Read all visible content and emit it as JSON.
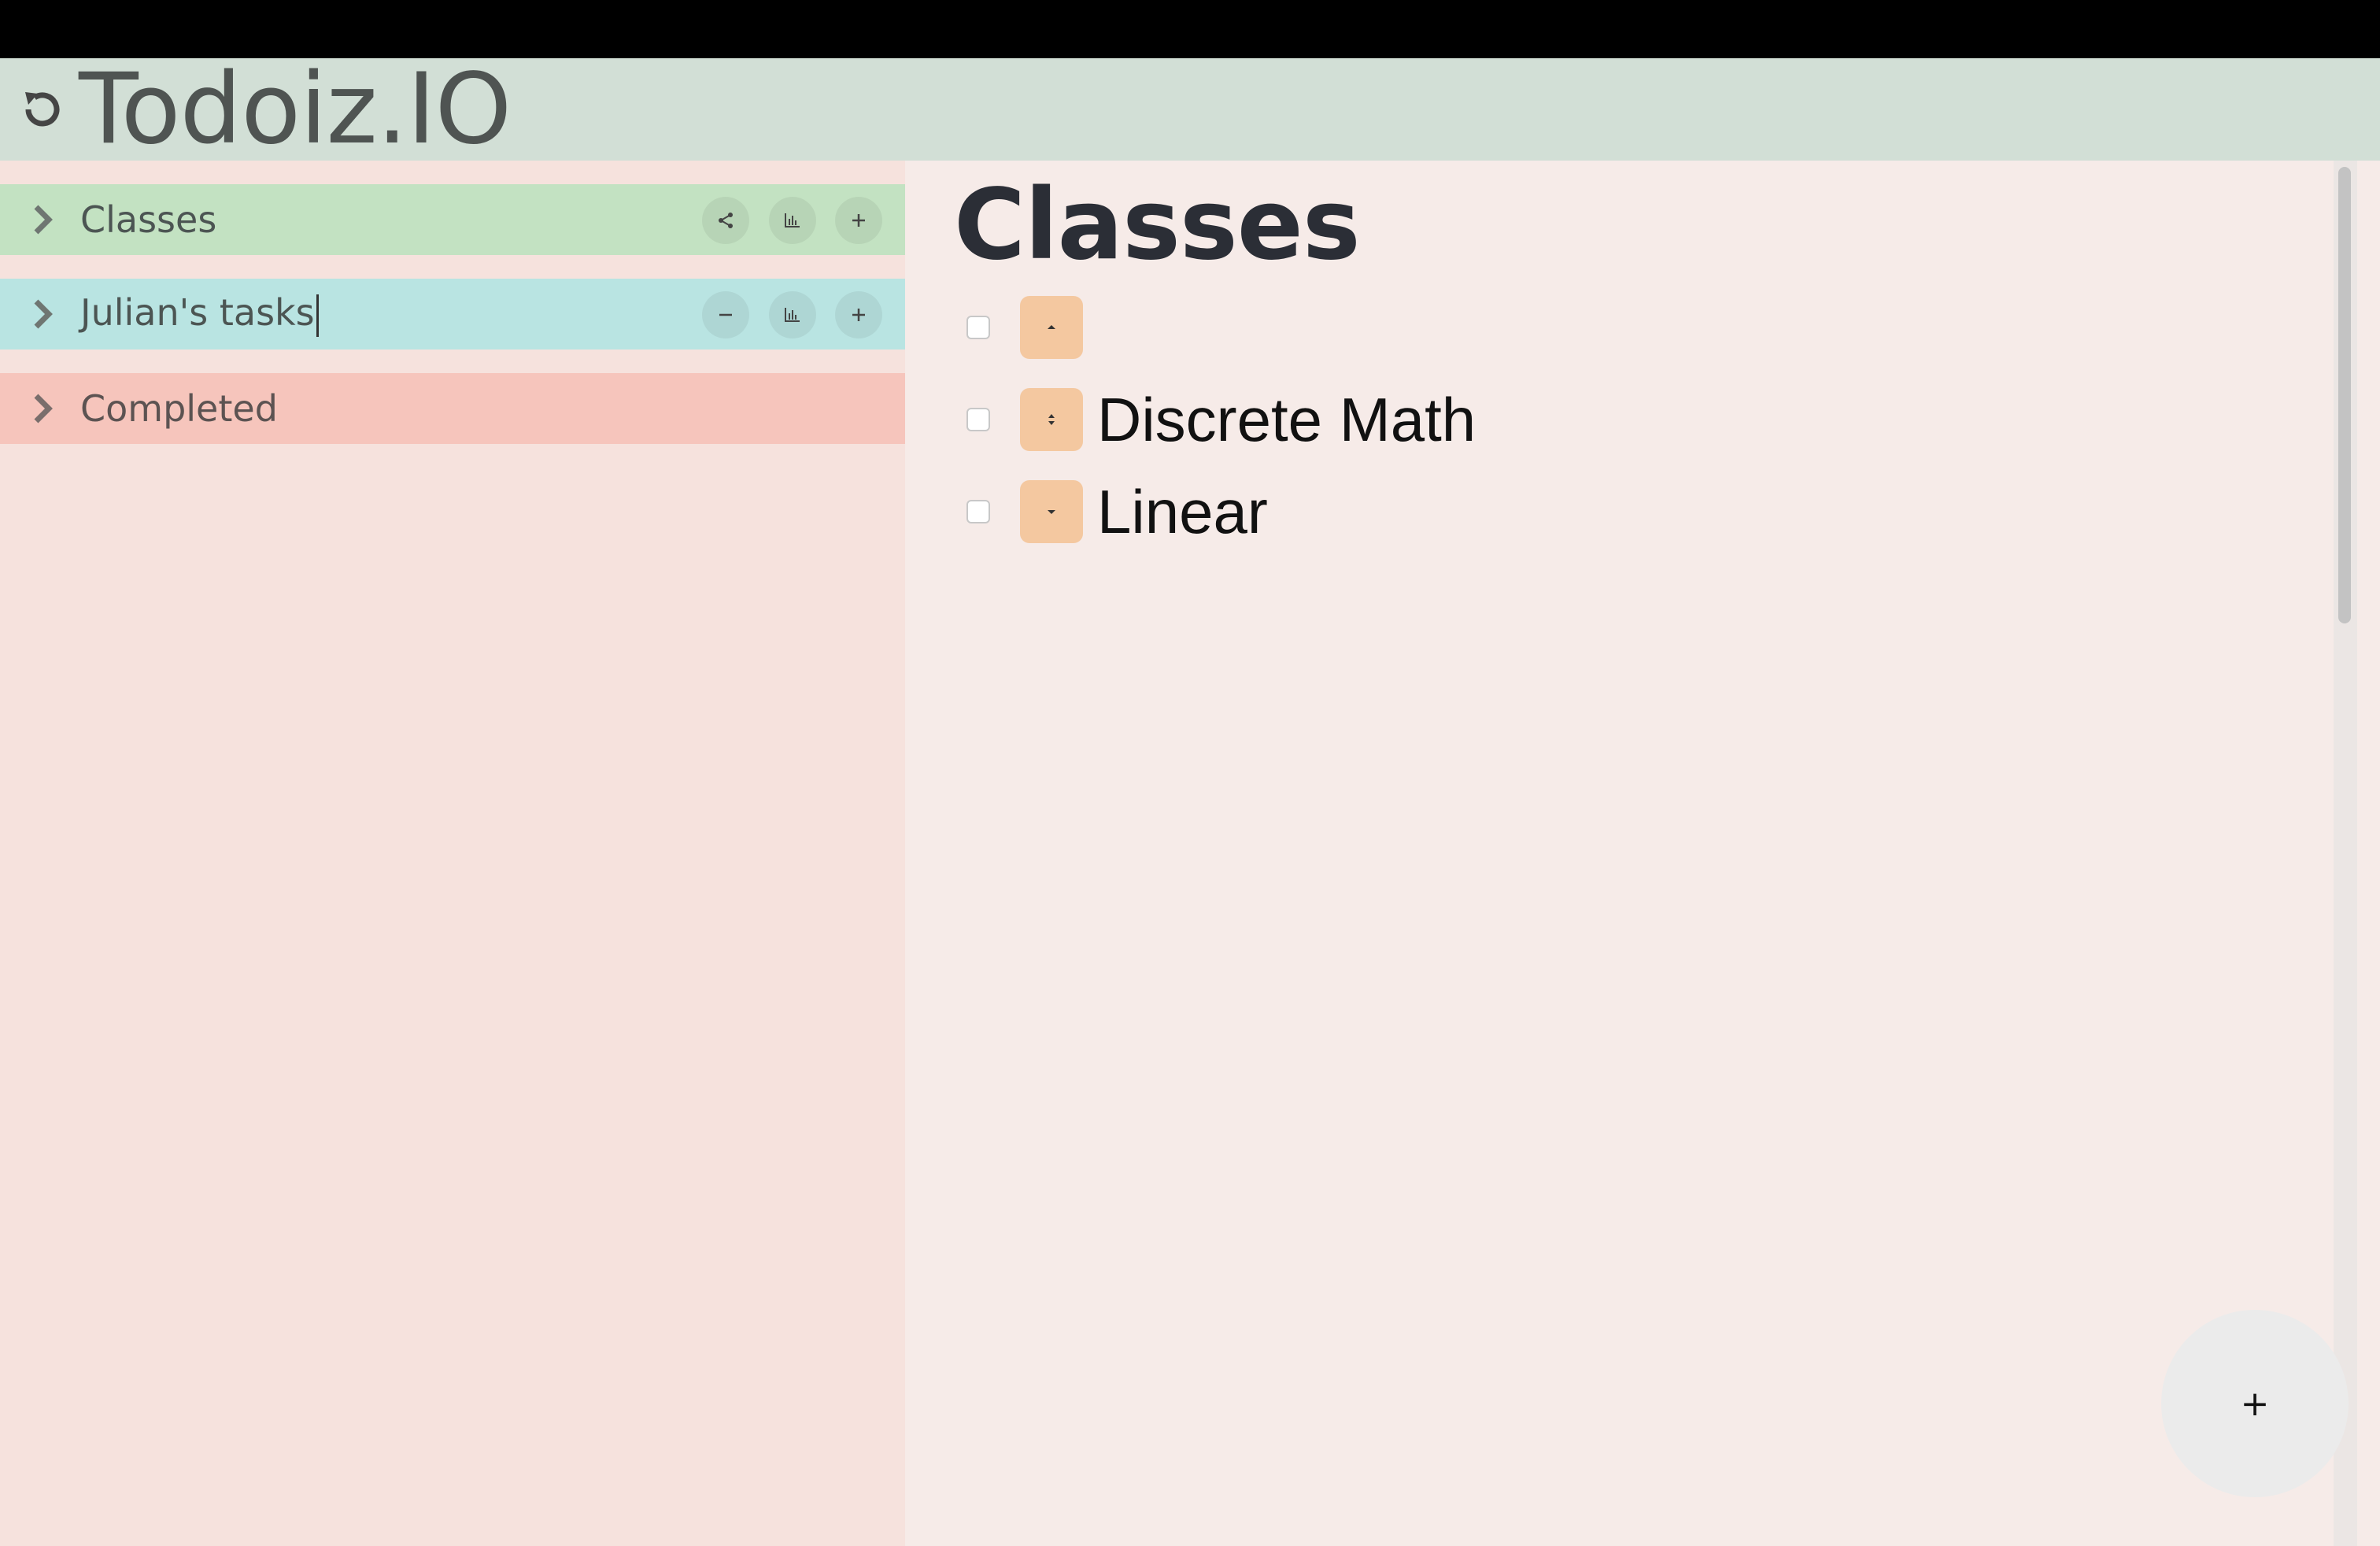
{
  "app": {
    "title": "Todoiz.IO"
  },
  "colors": {
    "header_bg": "#d2dfd6",
    "sidebar_bg": "#f6e2dd",
    "list_classes": "#c3e2c2",
    "list_julian": "#b9e4e2",
    "list_completed": "#f6c5bc",
    "handle": "#f4c8a0"
  },
  "sidebar": {
    "lists": [
      {
        "label": "Classes",
        "actions": [
          "share-icon",
          "chart-icon",
          "plus-icon"
        ]
      },
      {
        "label": "Julian's tasks",
        "actions": [
          "minus-icon",
          "chart-icon",
          "plus-icon"
        ],
        "editing": true
      },
      {
        "label": "Completed",
        "actions": []
      }
    ]
  },
  "main": {
    "heading": "Classes",
    "tasks": [
      {
        "label": "",
        "handle_icon": "move-down-only-icon"
      },
      {
        "label": "Discrete Math",
        "handle_icon": "move-up-down-icon"
      },
      {
        "label": "Linear",
        "handle_icon": "move-up-only-icon"
      }
    ]
  },
  "fab": {
    "label": "+"
  }
}
